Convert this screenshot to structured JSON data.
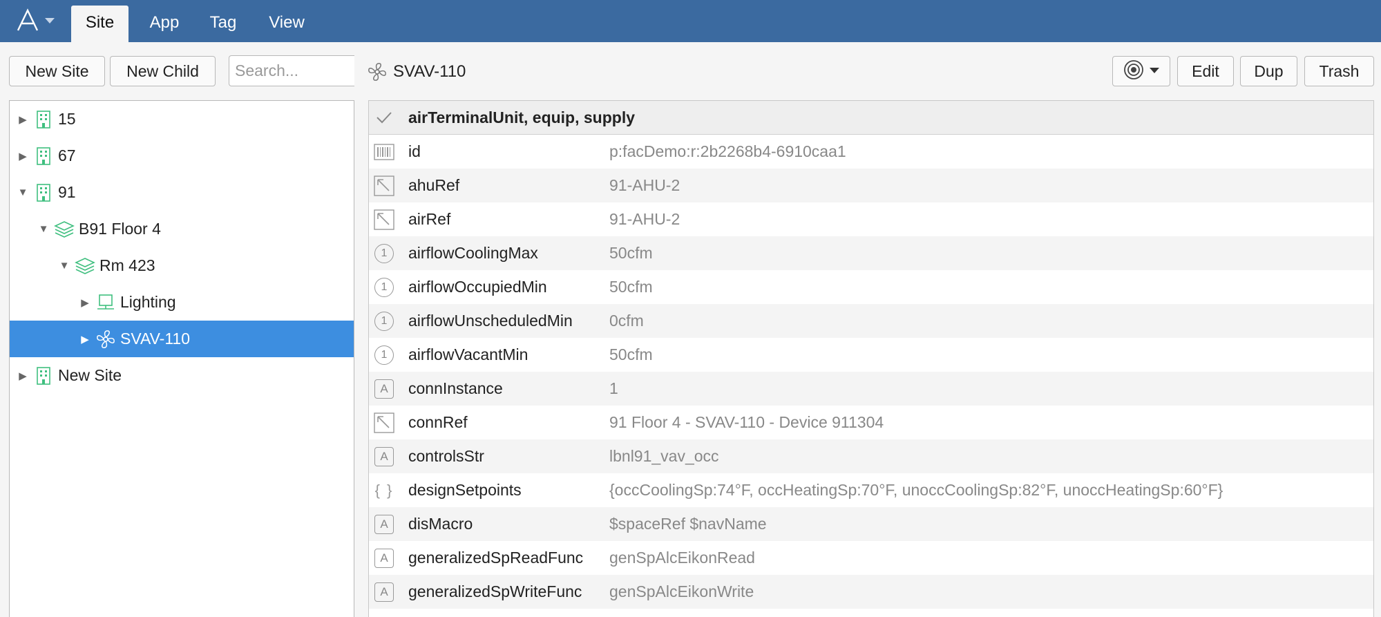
{
  "nav": {
    "tabs": [
      {
        "label": "Site"
      },
      {
        "label": "App"
      },
      {
        "label": "Tag"
      },
      {
        "label": "View"
      }
    ]
  },
  "toolbar": {
    "new_site_label": "New Site",
    "new_child_label": "New Child",
    "search_placeholder": "Search..."
  },
  "tree": {
    "items": [
      {
        "label": "15",
        "icon": "building-icon",
        "expanded": false
      },
      {
        "label": "67",
        "icon": "building-icon",
        "expanded": false
      },
      {
        "label": "91",
        "icon": "building-icon",
        "expanded": true
      },
      {
        "label": "B91 Floor 4",
        "icon": "floor-layers-icon",
        "expanded": true
      },
      {
        "label": "Rm 423",
        "icon": "floor-layers-icon",
        "expanded": true
      },
      {
        "label": "Lighting",
        "icon": "equip-icon",
        "expanded": false
      },
      {
        "label": "SVAV-110",
        "icon": "fan-icon",
        "expanded": false,
        "selected": true
      },
      {
        "label": "New Site",
        "icon": "building-icon",
        "expanded": false
      }
    ]
  },
  "record": {
    "title": "SVAV-110",
    "actions": {
      "edit_label": "Edit",
      "dup_label": "Dup",
      "trash_label": "Trash"
    },
    "markers": "airTerminalUnit, equip, supply",
    "tags": [
      {
        "name": "id",
        "value": "p:facDemo:r:2b2268b4-6910caa1",
        "kind": "barcode-icon"
      },
      {
        "name": "ahuRef",
        "value": "91-AHU-2",
        "kind": "ref-icon"
      },
      {
        "name": "airRef",
        "value": "91-AHU-2",
        "kind": "ref-icon"
      },
      {
        "name": "airflowCoolingMax",
        "value": "50cfm",
        "kind": "number-icon"
      },
      {
        "name": "airflowOccupiedMin",
        "value": "50cfm",
        "kind": "number-icon"
      },
      {
        "name": "airflowUnscheduledMin",
        "value": "0cfm",
        "kind": "number-icon"
      },
      {
        "name": "airflowVacantMin",
        "value": "50cfm",
        "kind": "number-icon"
      },
      {
        "name": "connInstance",
        "value": "1",
        "kind": "string-icon"
      },
      {
        "name": "connRef",
        "value": "91 Floor 4 - SVAV-110 - Device 911304",
        "kind": "ref-icon"
      },
      {
        "name": "controlsStr",
        "value": "lbnl91_vav_occ",
        "kind": "string-icon"
      },
      {
        "name": "designSetpoints",
        "value": "{occCoolingSp:74°F, occHeatingSp:70°F, unoccCoolingSp:82°F, unoccHeatingSp:60°F}",
        "kind": "dict-icon"
      },
      {
        "name": "disMacro",
        "value": "$spaceRef $navName",
        "kind": "string-icon"
      },
      {
        "name": "generalizedSpReadFunc",
        "value": "genSpAlcEikonRead",
        "kind": "string-icon"
      },
      {
        "name": "generalizedSpWriteFunc",
        "value": "genSpAlcEikonWrite",
        "kind": "string-icon"
      }
    ]
  },
  "colors": {
    "topbar": "#3b6aa0",
    "selected": "#3d8ee0",
    "icon_green": "#3fbf7f"
  }
}
